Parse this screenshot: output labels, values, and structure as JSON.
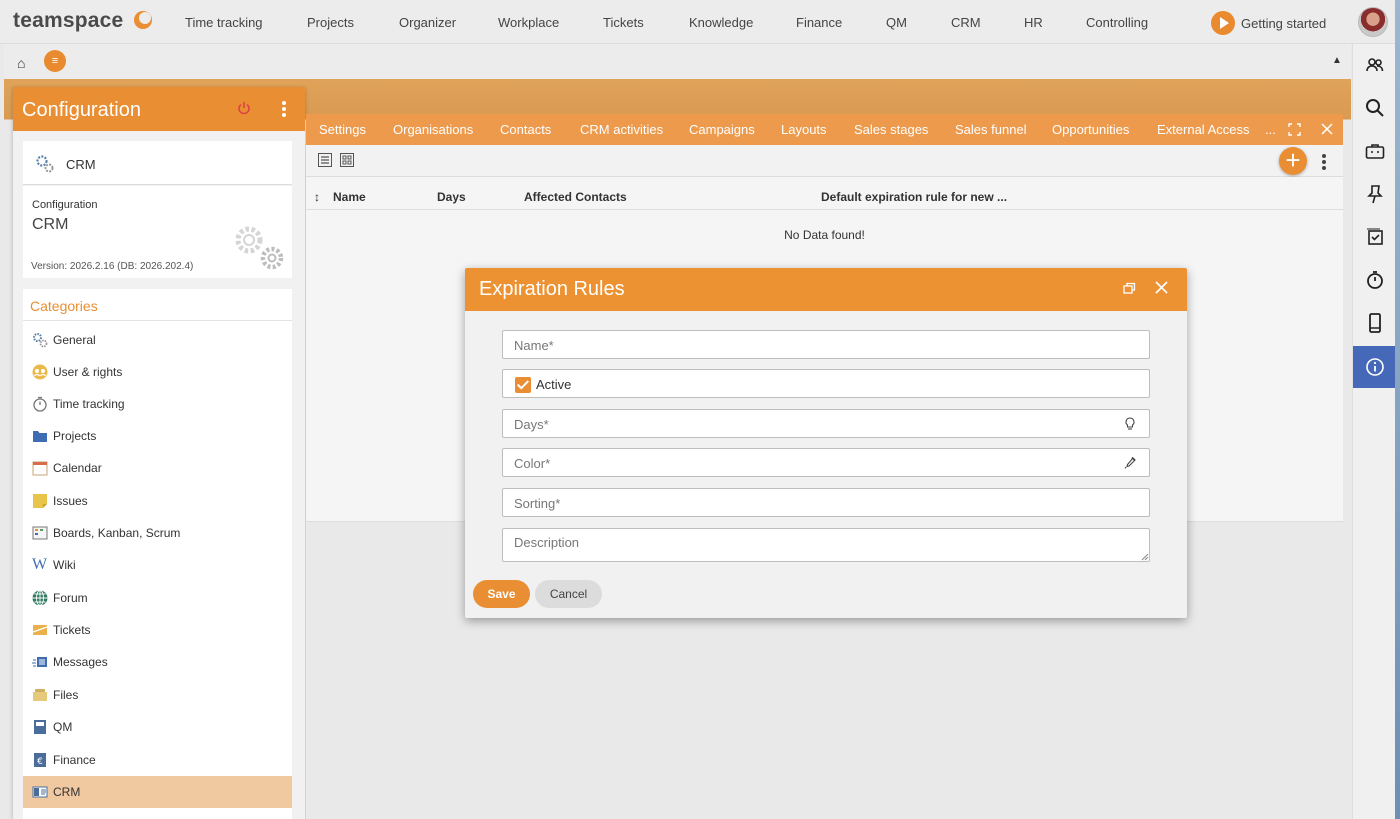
{
  "app": {
    "logo_text": "teamspace"
  },
  "topnav": {
    "items": [
      "Time tracking",
      "Projects",
      "Organizer",
      "Workplace",
      "Tickets",
      "Knowledge",
      "Finance",
      "QM",
      "CRM",
      "HR",
      "Controlling"
    ],
    "getting_started": "Getting started"
  },
  "config_panel": {
    "title": "Configuration",
    "module_label": "CRM",
    "info_small": "Configuration",
    "info_big": "CRM",
    "version": "Version: 2026.2.16 (DB: 2026.202.4)",
    "categories_title": "Categories",
    "categories": [
      {
        "label": "General",
        "icon": "gears-icon"
      },
      {
        "label": "User & rights",
        "icon": "users-icon"
      },
      {
        "label": "Time tracking",
        "icon": "stopwatch-icon"
      },
      {
        "label": "Projects",
        "icon": "folder-icon"
      },
      {
        "label": "Calendar",
        "icon": "calendar-icon"
      },
      {
        "label": "Issues",
        "icon": "sticky-note-icon"
      },
      {
        "label": "Boards, Kanban, Scrum",
        "icon": "board-icon"
      },
      {
        "label": "Wiki",
        "icon": "wiki-icon"
      },
      {
        "label": "Forum",
        "icon": "globe-icon"
      },
      {
        "label": "Tickets",
        "icon": "ticket-icon"
      },
      {
        "label": "Messages",
        "icon": "messages-icon"
      },
      {
        "label": "Files",
        "icon": "files-icon"
      },
      {
        "label": "QM",
        "icon": "qm-icon"
      },
      {
        "label": "Finance",
        "icon": "finance-icon"
      },
      {
        "label": "CRM",
        "icon": "crm-card-icon",
        "selected": true
      }
    ]
  },
  "main": {
    "tabs": [
      "Settings",
      "Organisations",
      "Contacts",
      "CRM activities",
      "Campaigns",
      "Layouts",
      "Sales stages",
      "Sales funnel",
      "Opportunities",
      "External Access",
      "..."
    ],
    "table": {
      "sort_glyph": "↕",
      "columns": [
        "Name",
        "Days",
        "Affected Contacts",
        "Default expiration rule for new ..."
      ],
      "empty_text": "No Data found!"
    },
    "plus_label": "+"
  },
  "dialog": {
    "title": "Expiration Rules",
    "fields": {
      "name_placeholder": "Name*",
      "active_label": "Active",
      "active_checked": true,
      "days_placeholder": "Days*",
      "color_placeholder": "Color*",
      "sorting_placeholder": "Sorting*",
      "description_placeholder": "Description"
    },
    "save_label": "Save",
    "cancel_label": "Cancel"
  },
  "colors": {
    "accent": "#e98e32",
    "tab_bar": "#ed9a4d",
    "active_sidebar": "#4568b8",
    "selected_category": "#f0c9a0"
  }
}
